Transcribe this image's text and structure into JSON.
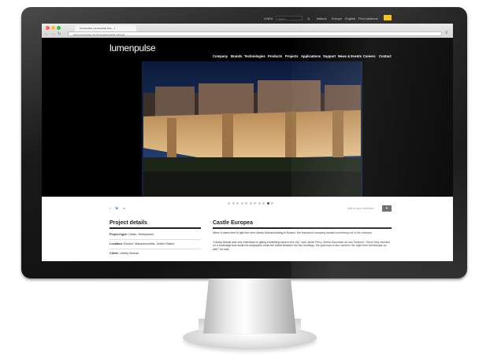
{
  "browser": {
    "tab_title": "Lumenpulse | lumenpulse Proj... ×",
    "url": "www.lumenpulse.com/en/projects/castle-europea"
  },
  "site": {
    "top_links": [
      "LINEA",
      "Search",
      "Q",
      "Italiano",
      "Europe",
      "English",
      "Find solutions"
    ],
    "logo": "lumenpulse",
    "nav": [
      "Company",
      "Brands",
      "Technologies",
      "Products",
      "Projects",
      "Applications",
      "Support",
      "News & Events",
      "Careers",
      "Contact"
    ],
    "social": [
      "f",
      "🐦",
      "in"
    ],
    "add_selection": "Add to your selection",
    "add_button": "▼",
    "project_details": {
      "heading": "Project details",
      "rows": [
        {
          "label": "Project type:",
          "value": "Urban, Workplaces"
        },
        {
          "label": "Location:",
          "value": "Boston, Massachusetts, United States"
        },
        {
          "label": "Client:",
          "value": "Liberty Mutual"
        }
      ]
    },
    "article": {
      "title": "Castle Europea",
      "p1": "When it came time to light the new Liberty Mutual building in Boston, the insurance company wanted something out of the ordinary.",
      "p2": "“Liberty Mutual was very interested in giving something back to the city,” said Jamie Perry, Senior Associate at Lam Partners. “Since they decided on a footbridge that would let employees cross the street between the two buildings, the goal was to also achieve the night time streetscape as well,” he said."
    },
    "carousel": {
      "count": 11,
      "active_index": 9
    }
  },
  "colors": {
    "bezel": "#111111",
    "accent": "#f0c000",
    "sky": "#10213f"
  }
}
